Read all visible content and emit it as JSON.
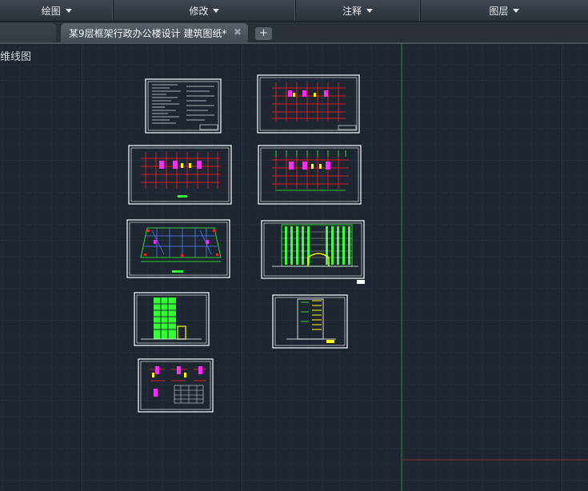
{
  "ribbon": {
    "panels": [
      {
        "label": "绘图"
      },
      {
        "label": "修改"
      },
      {
        "label": "注释"
      },
      {
        "label": "图层"
      }
    ]
  },
  "tabs": {
    "active_title": "某9层框架行政办公楼设计 建筑图纸*",
    "close_glyph": "✖",
    "new_tab_glyph": "+"
  },
  "viewport": {
    "label": "维线图"
  },
  "colors": {
    "background": "#1e2631",
    "grid_minor": "#262f3b",
    "grid_major": "#2f3a48",
    "ucs_y_axis": "#2f8a3a",
    "ucs_x_axis": "#8a2f2f",
    "sheet_border": "#ffffff",
    "walls": "#ff2020",
    "columns": "#ff2cff",
    "facade": "#33ff33",
    "accent": "#ffff00"
  }
}
